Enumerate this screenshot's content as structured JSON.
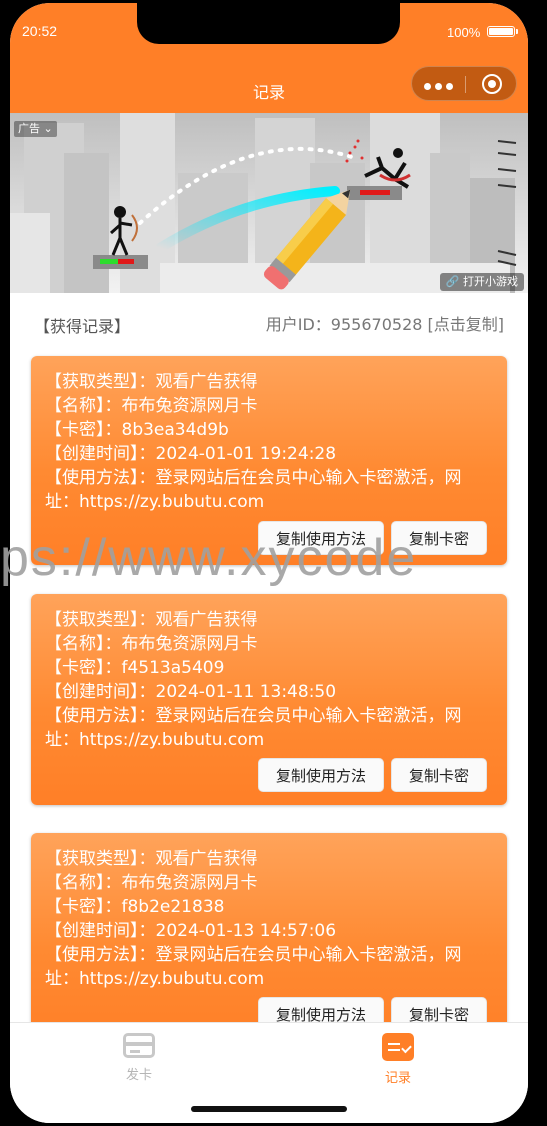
{
  "status_bar": {
    "time": "20:52",
    "battery": "100%"
  },
  "nav": {
    "title": "记录"
  },
  "ad": {
    "tag": "广告",
    "cta": "打开小游戏"
  },
  "records_header": {
    "title": "【获得记录】",
    "user_id": "用户ID：955670528 [点击复制]"
  },
  "records": [
    {
      "type": "【获取类型】：观看广告获得",
      "name": "【名称】：布布兔资源网月卡",
      "card_key": "【卡密】：8b3ea34d9b",
      "created": "【创建时间】：2024-01-01 19:24:28",
      "usage": "【使用方法】：登录网站后在会员中心输入卡密激活，网址：https://zy.bubutu.com",
      "copy_usage_label": "复制使用方法",
      "copy_key_label": "复制卡密"
    },
    {
      "type": "【获取类型】：观看广告获得",
      "name": "【名称】：布布兔资源网月卡",
      "card_key": "【卡密】：f4513a5409",
      "created": "【创建时间】：2024-01-11 13:48:50",
      "usage": "【使用方法】：登录网站后在会员中心输入卡密激活，网址：https://zy.bubutu.com",
      "copy_usage_label": "复制使用方法",
      "copy_key_label": "复制卡密"
    },
    {
      "type": "【获取类型】：观看广告获得",
      "name": "【名称】：布布兔资源网月卡",
      "card_key": "【卡密】：f8b2e21838",
      "created": "【创建时间】：2024-01-13 14:57:06",
      "usage": "【使用方法】：登录网站后在会员中心输入卡密激活，网址：https://zy.bubutu.com",
      "copy_usage_label": "复制使用方法",
      "copy_key_label": "复制卡密"
    }
  ],
  "watermark": "ps://www.xycode",
  "tabbar": {
    "items": [
      {
        "label": "发卡",
        "icon": "card-icon",
        "active": false
      },
      {
        "label": "记录",
        "icon": "record-icon",
        "active": true
      }
    ]
  },
  "colors": {
    "accent": "#ff7f27",
    "inactive": "#b5b5b5"
  }
}
